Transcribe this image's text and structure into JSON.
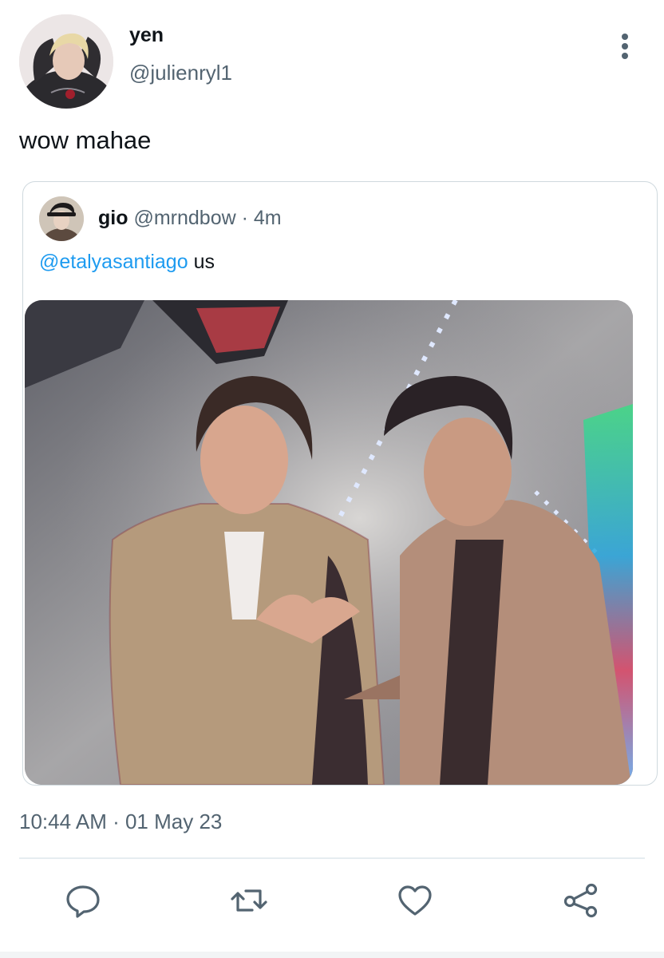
{
  "tweet": {
    "author": {
      "name": "yen",
      "handle": "@julienryl1"
    },
    "text": "wow mahae",
    "timestamp": "10:44 AM · 01 May 23"
  },
  "quoted_tweet": {
    "name": "gio",
    "handle": "@mrndbow",
    "separator": "·",
    "time": "4m",
    "mention": "@etalyasantiago",
    "text": "us",
    "media": "photo"
  },
  "actions": [
    "reply-icon",
    "retweet-icon",
    "like-icon",
    "share-icon"
  ],
  "colors": {
    "text_primary": "#0f1419",
    "text_secondary": "#536471",
    "link": "#1d9bf0",
    "border": "#cfd9de"
  }
}
